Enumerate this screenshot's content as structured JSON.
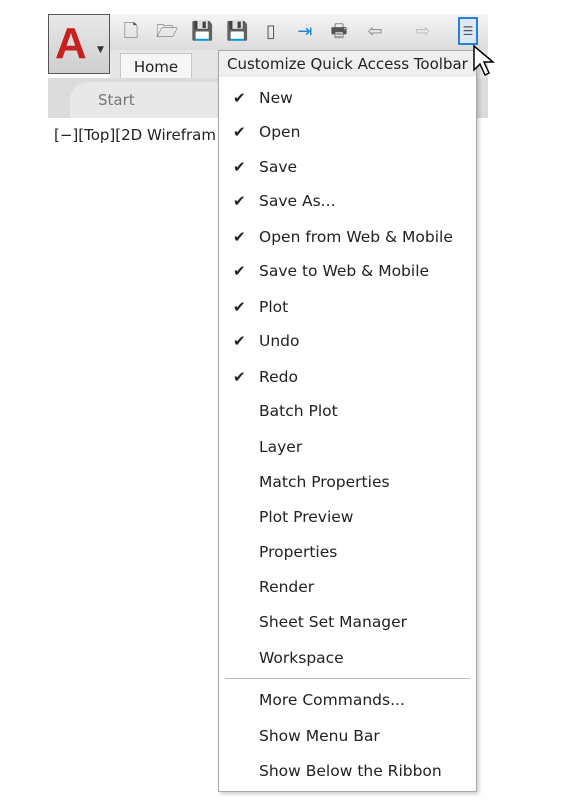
{
  "app": {
    "logo_letter": "A",
    "accent": "#c8201e"
  },
  "quick_access": {
    "icons": [
      "new-icon",
      "open-icon",
      "save-icon",
      "save-as-icon",
      "open-web-mobile-icon",
      "save-web-mobile-icon",
      "plot-icon",
      "undo-icon",
      "redo-icon",
      "customize-dropdown-icon"
    ]
  },
  "ribbon": {
    "home_tab": "Home",
    "start_tab": "Start"
  },
  "viewport": {
    "label": "[−][Top][2D Wirefram"
  },
  "menu": {
    "title": "Customize Quick Access Toolbar",
    "items": [
      {
        "label": "New",
        "checked": true
      },
      {
        "label": "Open",
        "checked": true
      },
      {
        "label": "Save",
        "checked": true
      },
      {
        "label": "Save As...",
        "checked": true
      },
      {
        "label": "Open from Web & Mobile",
        "checked": true
      },
      {
        "label": "Save to Web & Mobile",
        "checked": true
      },
      {
        "label": "Plot",
        "checked": true
      },
      {
        "label": "Undo",
        "checked": true
      },
      {
        "label": "Redo",
        "checked": true
      },
      {
        "label": "Batch Plot",
        "checked": false
      },
      {
        "label": "Layer",
        "checked": false
      },
      {
        "label": "Match Properties",
        "checked": false
      },
      {
        "label": "Plot Preview",
        "checked": false
      },
      {
        "label": "Properties",
        "checked": false
      },
      {
        "label": "Render",
        "checked": false
      },
      {
        "label": "Sheet Set Manager",
        "checked": false
      },
      {
        "label": "Workspace",
        "checked": false
      }
    ],
    "extra": [
      {
        "label": "More Commands..."
      },
      {
        "label": "Show Menu Bar"
      },
      {
        "label": "Show Below the Ribbon"
      }
    ]
  }
}
